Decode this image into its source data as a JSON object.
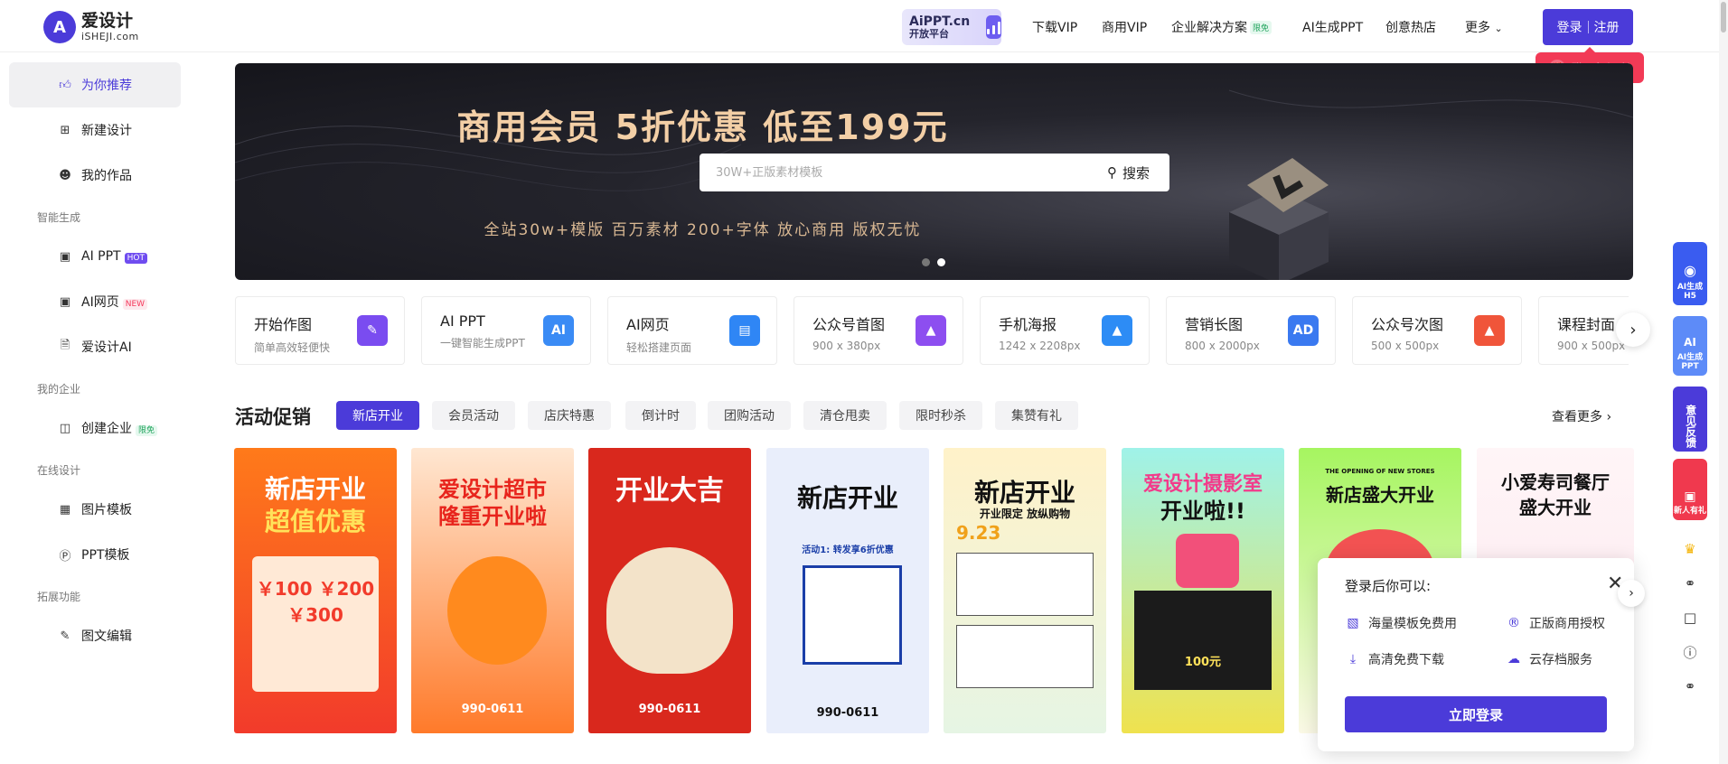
{
  "header": {
    "logo_cn": "爱设计",
    "logo_en": "iSHEJI.com",
    "aippt_line1": "AiPPT.cn",
    "aippt_line2": "开放平台",
    "nav": [
      {
        "label": "下载VIP"
      },
      {
        "label": "商用VIP"
      },
      {
        "label": "企业解决方案",
        "tag": "限免"
      },
      {
        "label": "AI生成PPT"
      },
      {
        "label": "创意热店"
      },
      {
        "label": "更多"
      }
    ],
    "login": "登录",
    "register": "注册",
    "gift_tip": "登录领福利"
  },
  "sidebar": {
    "items": [
      {
        "label": "为你推荐",
        "icon": "thumbs-up-icon"
      },
      {
        "label": "新建设计",
        "icon": "plus-square-icon"
      },
      {
        "label": "我的作品",
        "icon": "user-icon"
      },
      {
        "label": "AI PPT",
        "icon": "scan-icon",
        "badge": "HOT"
      },
      {
        "label": "AI网页",
        "icon": "scan-icon",
        "badge": "NEW"
      },
      {
        "label": "爱设计AI",
        "icon": "doc-ai-icon"
      },
      {
        "label": "创建企业",
        "icon": "briefcase-icon",
        "badge": "限免"
      },
      {
        "label": "图片模板",
        "icon": "grid-icon"
      },
      {
        "label": "PPT模板",
        "icon": "ppt-icon"
      },
      {
        "label": "图文编辑",
        "icon": "pen-icon"
      }
    ],
    "sections": [
      "智能生成",
      "我的企业",
      "在线设计",
      "拓展功能"
    ]
  },
  "banner": {
    "title": "商用会员 5折优惠 低至199元",
    "search_placeholder": "30W+正版素材模板",
    "search_button": "搜索",
    "subtitle": "全站30w+模版 百万素材  200+字体 放心商用 版权无忧"
  },
  "tools": [
    {
      "title": "开始作图",
      "sub": "简单高效轻便快",
      "color": "#7a4cf0"
    },
    {
      "title": "AI PPT",
      "sub": "一键智能生成PPT",
      "color": "#3a8bf5",
      "glyph": "AI"
    },
    {
      "title": "AI网页",
      "sub": "轻松搭建页面",
      "color": "#2f86f5"
    },
    {
      "title": "公众号首图",
      "sub": "900 x 380px",
      "color": "#8d4ef0"
    },
    {
      "title": "手机海报",
      "sub": "1242 x 2208px",
      "color": "#2d8cf5"
    },
    {
      "title": "营销长图",
      "sub": "800 x 2000px",
      "color": "#3a79f0",
      "glyph": "AD"
    },
    {
      "title": "公众号次图",
      "sub": "500 x 500px",
      "color": "#f0553a"
    },
    {
      "title": "课程封面",
      "sub": "900 x 500px",
      "color": "#f08a3a"
    }
  ],
  "activity": {
    "title": "活动促销",
    "chips": [
      "新店开业",
      "会员活动",
      "店庆特惠",
      "倒计时",
      "团购活动",
      "清仓甩卖",
      "限时秒杀",
      "集赞有礼"
    ],
    "see_more": "查看更多"
  },
  "posters": [
    {
      "headline": "新店开业",
      "headline2": "超值优惠",
      "foot": "￥100  ￥200  ￥300"
    },
    {
      "headline": "爱设计超市",
      "headline2": "隆重开业啦",
      "foot": "990-0611"
    },
    {
      "headline": "开业大吉",
      "headline2": "",
      "foot": "990-0611"
    },
    {
      "headline": "新店开业",
      "headline2": "活动1: 转发享6折优惠",
      "foot": "990-0611"
    },
    {
      "headline": "新店开业",
      "headline2": "开业限定 放纵购物",
      "foot": "9.23"
    },
    {
      "headline": "爱设计摄影室",
      "headline2": "开业啦!!",
      "foot": "100元"
    },
    {
      "headline": "新店盛大开业",
      "headline2": "THE OPENING OF NEW STORES",
      "foot": ""
    },
    {
      "headline": "小爱寿司餐厅",
      "headline2": "盛大开业",
      "foot": ""
    }
  ],
  "login_popup": {
    "title": "登录后你可以:",
    "features": [
      "海量模板免费用",
      "正版商用授权",
      "高清免费下载",
      "云存档服务"
    ],
    "button": "立即登录"
  },
  "float_bar": [
    {
      "label": "AI生成H5",
      "color": "#3a5cf0"
    },
    {
      "label": "AI生成PPT",
      "color": "#5d8bf8"
    },
    {
      "label": "意见反馈",
      "color": "#4b3bd9"
    },
    {
      "label": "新人有礼",
      "color": "#f0394e"
    }
  ]
}
